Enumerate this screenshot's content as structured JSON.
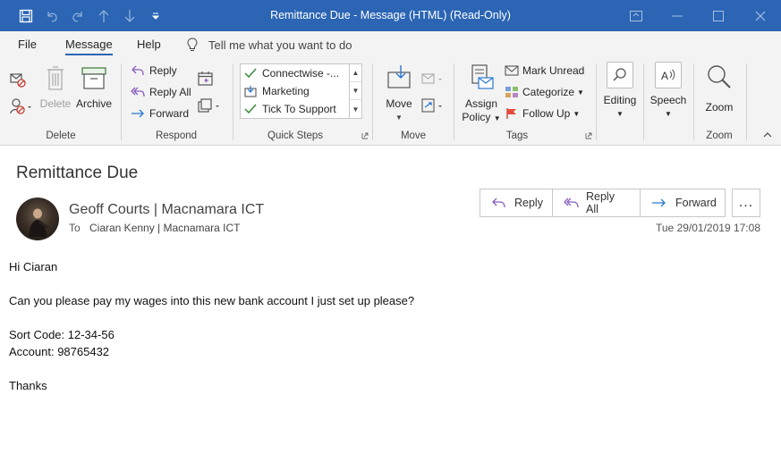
{
  "window": {
    "title": "Remittance Due  -  Message (HTML) (Read-Only)"
  },
  "tabs": [
    {
      "label": "File"
    },
    {
      "label": "Message"
    },
    {
      "label": "Help"
    }
  ],
  "tell_me": {
    "placeholder": "Tell me what you want to do"
  },
  "ribbon": {
    "delete": {
      "label": "Delete",
      "delete_btn": "Delete",
      "archive_btn": "Archive"
    },
    "respond": {
      "label": "Respond",
      "reply": "Reply",
      "reply_all": "Reply All",
      "forward": "Forward"
    },
    "quick_steps": {
      "label": "Quick Steps",
      "items": [
        "Connectwise -...",
        "Marketing",
        "Tick To Support"
      ]
    },
    "move": {
      "label": "Move",
      "move_btn": "Move"
    },
    "tags": {
      "label": "Tags",
      "assign_policy_1": "Assign",
      "assign_policy_2": "Policy",
      "mark_unread": "Mark Unread",
      "categorize": "Categorize",
      "follow_up": "Follow Up"
    },
    "editing": {
      "label": "Editing"
    },
    "speech": {
      "label": "Speech"
    },
    "zoom": {
      "label": "Zoom",
      "zoom_btn": "Zoom"
    }
  },
  "message": {
    "subject": "Remittance Due",
    "sender": "Geoff Courts | Macnamara ICT",
    "to_label": "To",
    "to": "Ciaran Kenny | Macnamara ICT",
    "date": "Tue 29/01/2019 17:08",
    "actions": {
      "reply": "Reply",
      "reply_all": "Reply All",
      "forward": "Forward",
      "more": "..."
    },
    "body": [
      "Hi Ciaran",
      "",
      "Can you please pay my wages into this new bank account I just set up please?",
      "",
      "Sort Code: 12-34-56",
      "Account: 98765432",
      "",
      "Thanks"
    ]
  },
  "colors": {
    "titlebar": "#2b65b4",
    "ribbon_bg": "#f3f3f3",
    "accent_purple": "#8a5dbd",
    "accent_blue": "#2b79d0"
  }
}
